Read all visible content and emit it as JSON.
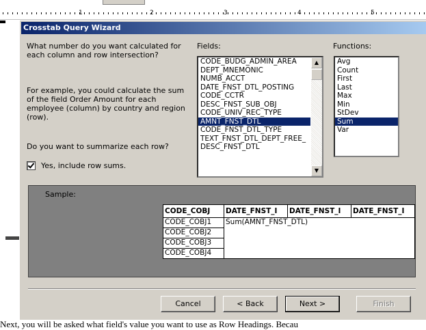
{
  "ruler": {
    "numbers": [
      "1",
      "2",
      "3",
      "4",
      "5"
    ]
  },
  "background_text": "Next, you will be asked what field's value you want to use as Row Headings. Becau",
  "dialog": {
    "title": "Crosstab Query Wizard",
    "prompt1": "What number do you want calculated for each column and row intersection?",
    "prompt2": "For example, you could calculate the sum of the field Order Amount for each employee (column)  by country and region (row).",
    "prompt3": "Do you want to summarize each row?",
    "checkbox": {
      "label": "Yes, include row sums.",
      "checked": true
    }
  },
  "fields": {
    "label": "Fields:",
    "items": [
      "CODE_BUDG_ADMIN_AREA",
      "DEPT_MNEMONIC",
      "NUMB_ACCT",
      "DATE_FNST_DTL_POSTING",
      "CODE_CCTR",
      "DESC_FNST_SUB_OBJ",
      "CODE_UNIV_REC_TYPE",
      "AMNT_FNST_DTL",
      "CODE_FNST_DTL_TYPE",
      "TEXT_FNST_DTL_DEPT_FREE_",
      "DESC_FNST_DTL"
    ],
    "selected": "AMNT_FNST_DTL"
  },
  "functions": {
    "label": "Functions:",
    "items": [
      "Avg",
      "Count",
      "First",
      "Last",
      "Max",
      "Min",
      "StDev",
      "Sum",
      "Var"
    ],
    "selected": "Sum"
  },
  "sample": {
    "label": "Sample:",
    "headers": [
      "CODE_COBJ",
      "DATE_FNST_I",
      "DATE_FNST_I",
      "DATE_FNST_I"
    ],
    "rows": [
      "CODE_COBJ1",
      "CODE_COBJ2",
      "CODE_COBJ3",
      "CODE_COBJ4"
    ],
    "value": "Sum(AMNT_FNST_DTL)"
  },
  "buttons": {
    "cancel": "Cancel",
    "back": "< Back",
    "next": "Next >",
    "finish": "Finish"
  }
}
